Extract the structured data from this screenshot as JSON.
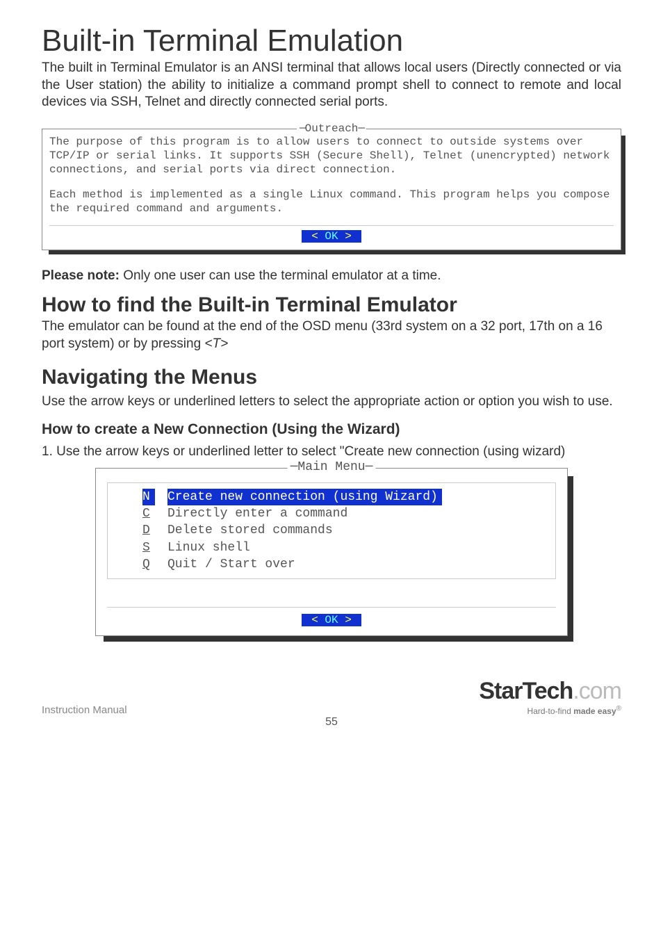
{
  "h1": "Built-in Terminal Emulation",
  "intro": "The built in Terminal Emulator is an ANSI terminal that allows local users (Directly connected or via the User station) the ability to initialize a command prompt shell to connect to remote and local devices via SSH, Telnet and directly connected serial ports.",
  "outreach": {
    "title": "Outreach",
    "p1": "The purpose of this program is to allow users to connect to outside systems over TCP/IP or serial links. It supports SSH (Secure Shell), Telnet (unencrypted) network connections, and serial ports via direct connection.",
    "p2": "Each method is implemented as a single Linux command. This program helps you compose the required command and arguments.",
    "ok": "OK"
  },
  "note_label": "Please note:",
  "note_text": " Only one user can use the terminal emulator at a time.",
  "h2a": "How to find the Built-in Terminal Emulator",
  "h2a_body_a": "The emulator can be found at the end of the OSD menu (33rd system on a 32 port, 17th on a 16 port system) or by pressing ",
  "h2a_key": "<T>",
  "h2b": "Navigating the Menus",
  "h2b_body": "Use the arrow keys or underlined letters to select the appropriate action or option you wish to use.",
  "h3": "How to create a New Connection (Using the Wizard)",
  "step1": "1.  Use the arrow keys or underlined letter to select \"Create new connection (using wizard)",
  "menu": {
    "title": "Main Menu",
    "items": [
      {
        "key": "N",
        "label": "Create new connection (using Wizard)",
        "selected": true
      },
      {
        "key": "C",
        "label": "Directly enter a command",
        "selected": false
      },
      {
        "key": "D",
        "label": "Delete stored commands",
        "selected": false
      },
      {
        "key": "S",
        "label": "Linux shell",
        "selected": false
      },
      {
        "key": "Q",
        "label": "Quit / Start over",
        "selected": false
      }
    ],
    "ok": "OK"
  },
  "footer": {
    "left": "Instruction Manual",
    "page": "55",
    "brand_a": "StarTech",
    "brand_b": ".com",
    "tag_a": "Hard-to-find ",
    "tag_b": "made easy"
  }
}
